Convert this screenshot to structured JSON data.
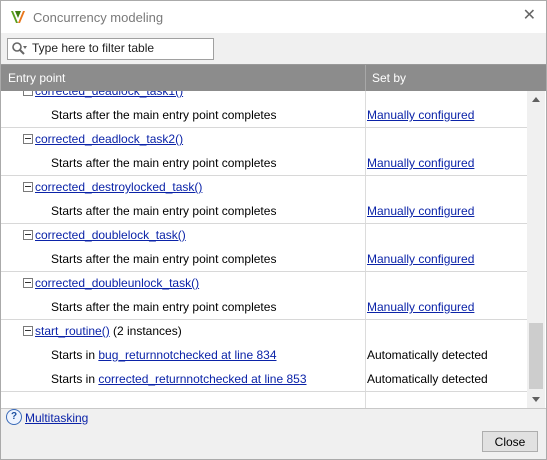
{
  "window": {
    "title": "Concurrency modeling",
    "close_glyph": "✕"
  },
  "filter": {
    "placeholder": "Type here to filter table",
    "icon": "search-filter-icon"
  },
  "table": {
    "columns": [
      "Entry point",
      "Set by"
    ],
    "groups": [
      {
        "name": "corrected_deadlock_task1()",
        "instances": "",
        "rows": [
          {
            "text": "Starts after the main entry point completes",
            "link": "",
            "suffix": "",
            "set_by": "Manually configured",
            "set_by_link": true
          }
        ]
      },
      {
        "name": "corrected_deadlock_task2()",
        "instances": "",
        "rows": [
          {
            "text": "Starts after the main entry point completes",
            "link": "",
            "suffix": "",
            "set_by": "Manually configured",
            "set_by_link": true
          }
        ]
      },
      {
        "name": "corrected_destroylocked_task()",
        "instances": "",
        "rows": [
          {
            "text": "Starts after the main entry point completes",
            "link": "",
            "suffix": "",
            "set_by": "Manually configured",
            "set_by_link": true
          }
        ]
      },
      {
        "name": "corrected_doublelock_task()",
        "instances": "",
        "rows": [
          {
            "text": "Starts after the main entry point completes",
            "link": "",
            "suffix": "",
            "set_by": "Manually configured",
            "set_by_link": true
          }
        ]
      },
      {
        "name": "corrected_doubleunlock_task()",
        "instances": "",
        "rows": [
          {
            "text": "Starts after the main entry point completes",
            "link": "",
            "suffix": "",
            "set_by": "Manually configured",
            "set_by_link": true
          }
        ]
      },
      {
        "name": "start_routine()",
        "instances": "(2 instances)",
        "rows": [
          {
            "text": "Starts in ",
            "link": "bug_returnnotchecked at line 834",
            "suffix": "",
            "set_by": "Automatically detected",
            "set_by_link": false
          },
          {
            "text": "Starts in ",
            "link": "corrected_returnnotchecked at line 853",
            "suffix": "",
            "set_by": "Automatically detected",
            "set_by_link": false
          }
        ]
      }
    ]
  },
  "footer": {
    "help_icon": "help-icon",
    "help_glyph": "?",
    "help_link": "Multitasking",
    "close_label": "Close"
  },
  "colors": {
    "link": "#0b23a8",
    "header_bg": "#8c8c8c",
    "app_icon_green": "#5a9e1f",
    "app_icon_orange": "#e8771c"
  }
}
